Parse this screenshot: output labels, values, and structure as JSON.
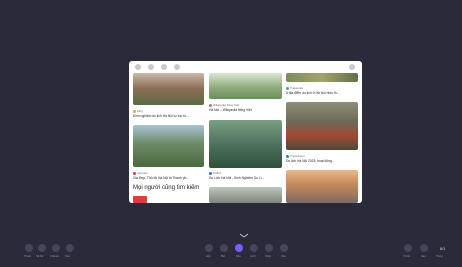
{
  "card": {
    "items": [
      {
        "source": "Zing",
        "title": "Kinh nghiệm du lịch Hà Nội tự túc tố...",
        "dot": "#f5a623"
      },
      {
        "source": "Wikipedia tiếng Việt",
        "title": "Hà Nội – Wikipedia tiếng Việt",
        "dot": "#8a8a8a"
      },
      {
        "source": "Traveloka",
        "title": "5 địa điểm du lịch ở Hà Nội nhìn th...",
        "dot": "#3cb371"
      },
      {
        "source": "Vietnam",
        "title": "Gia Đẹp, Thủ đô Hà Nội là Thành ph...",
        "dot": "#e23b3b"
      },
      {
        "source": "Dulich",
        "title": "Du Lịch Hà Nội - Kinh Nghiệm Du Lị...",
        "dot": "#2f6fd6"
      },
      {
        "source": "Tripadvisor",
        "title": "Du lịch Hà Nội 2023: hoạt động...",
        "dot": "#1a9c6b"
      }
    ],
    "related_heading": "Mọi người cũng tìm kiếm"
  },
  "bottom_left": [
    "Thoát",
    "Xã hội",
    "Chia sẻ",
    "Xoá"
  ],
  "bottom_center": [
    "Hủy",
    "Bút",
    "Dấu",
    "Lưới",
    "Chèn",
    "Xóa"
  ],
  "bottom_right": [
    "Trước",
    "Sau",
    "Trang"
  ],
  "page_indicator": "8/1",
  "colors": {
    "background": "#2b2a3b",
    "accent": "#7b5cff"
  }
}
